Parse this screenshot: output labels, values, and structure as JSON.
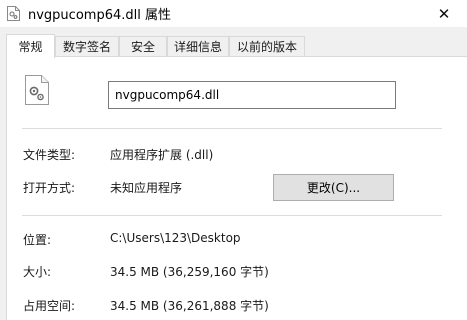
{
  "window": {
    "title": "nvgpucomp64.dll 属性",
    "close_symbol": "✕"
  },
  "tabs": [
    {
      "label": "常规",
      "active": true
    },
    {
      "label": "数字签名",
      "active": false
    },
    {
      "label": "安全",
      "active": false
    },
    {
      "label": "详细信息",
      "active": false
    },
    {
      "label": "以前的版本",
      "active": false
    }
  ],
  "general": {
    "file_name": "nvgpucomp64.dll",
    "file_type_label": "文件类型:",
    "file_type_value": "应用程序扩展 (.dll)",
    "opens_with_label": "打开方式:",
    "opens_with_value": "未知应用程序",
    "change_button": "更改(C)...",
    "location_label": "位置:",
    "location_value": "C:\\Users\\123\\Desktop",
    "size_label": "大小:",
    "size_value": "34.5 MB (36,259,160 字节)",
    "size_on_disk_label": "占用空间:",
    "size_on_disk_value": "34.5 MB (36,261,888 字节)"
  }
}
